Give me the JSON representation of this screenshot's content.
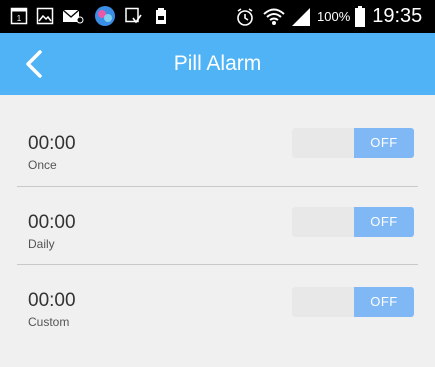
{
  "status_bar": {
    "battery_percent": "100%",
    "time": "19:35",
    "left_icons": [
      "calendar-icon",
      "gallery-icon",
      "mail-icon",
      "app-icon",
      "download-icon",
      "battery-app-icon"
    ],
    "right_icons": [
      "alarm-icon",
      "wifi-icon",
      "signal-icon",
      "battery-icon"
    ]
  },
  "app_bar": {
    "title": "Pill Alarm",
    "back_icon": "back-arrow-icon",
    "color": "#4fb3f5"
  },
  "alarms": [
    {
      "time": "00:00",
      "frequency": "Once",
      "state": "OFF"
    },
    {
      "time": "00:00",
      "frequency": "Daily",
      "state": "OFF"
    },
    {
      "time": "00:00",
      "frequency": "Custom",
      "state": "OFF"
    }
  ],
  "colors": {
    "toggle_off": "#7fb8f5",
    "background": "#f0f0f0"
  }
}
